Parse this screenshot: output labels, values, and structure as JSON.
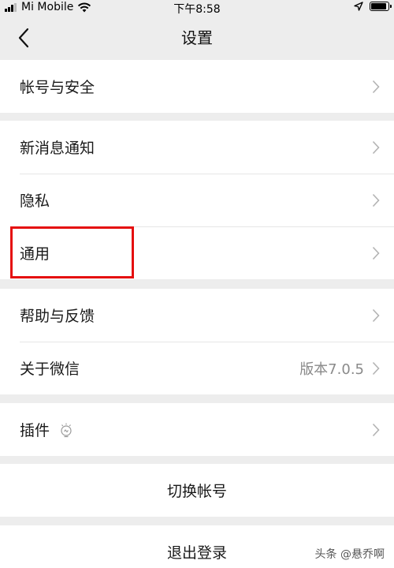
{
  "status_bar": {
    "carrier": "Mi Mobile",
    "time": "下午8:58",
    "battery_level": 0.9
  },
  "nav": {
    "title": "设置"
  },
  "groups": [
    {
      "items": [
        {
          "label": "帐号与安全"
        }
      ]
    },
    {
      "items": [
        {
          "label": "新消息通知"
        },
        {
          "label": "隐私"
        },
        {
          "label": "通用"
        }
      ]
    },
    {
      "items": [
        {
          "label": "帮助与反馈"
        },
        {
          "label": "关于微信",
          "value": "版本7.0.5"
        }
      ]
    },
    {
      "items": [
        {
          "label": "插件"
        }
      ]
    }
  ],
  "actions": {
    "switch_account": "切换帐号",
    "logout": "退出登录"
  },
  "annotation": {
    "highlight_color": "#e50f0f"
  },
  "watermark": "头条 @悬乔啊",
  "colors": {
    "background": "#ededed",
    "cell": "#ffffff",
    "secondary_text": "#8a8a8a"
  }
}
